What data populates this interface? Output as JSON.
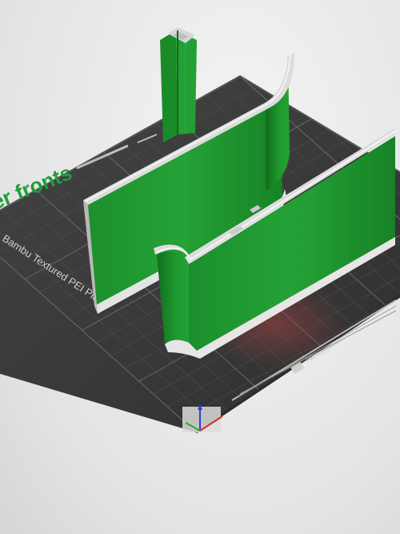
{
  "scene": {
    "plate_name": "Bambu Textured PEI Plate",
    "partial_title": "er fronts",
    "colors": {
      "background": "#ececec",
      "plate": "#3a3a3a",
      "grid": "#5a5a5a",
      "model_green": "#1f9a2f",
      "model_green_dark": "#137a20",
      "model_edge": "#d9d9d9",
      "accent_title": "#1f9e3a"
    }
  }
}
